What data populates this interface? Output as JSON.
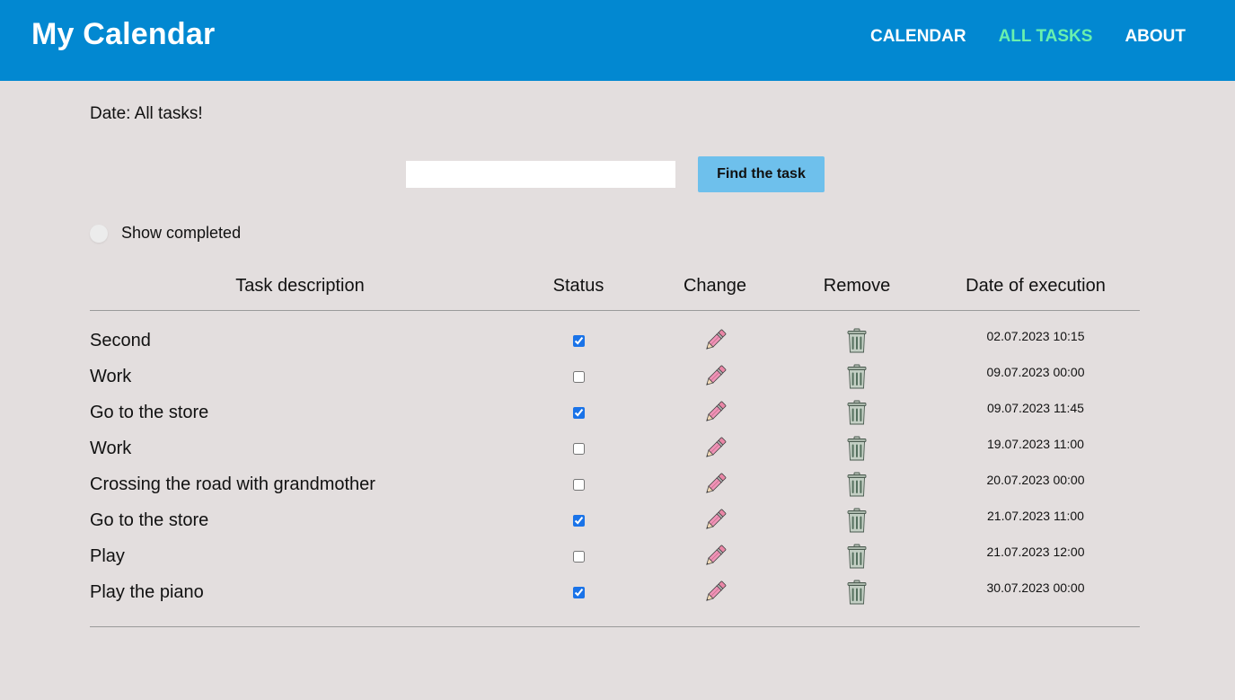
{
  "header": {
    "brand": "My Calendar",
    "nav": [
      {
        "label": "CALENDAR",
        "active": false
      },
      {
        "label": "ALL TASKS",
        "active": true
      },
      {
        "label": "ABOUT",
        "active": false
      }
    ],
    "colors": {
      "bar": "#0288d1",
      "active_link": "#69f0ae"
    }
  },
  "main": {
    "date_line": "Date: All tasks!",
    "search": {
      "value": "",
      "placeholder": ""
    },
    "find_button_label": "Find the task",
    "show_completed": {
      "label": "Show completed",
      "checked": false
    }
  },
  "table": {
    "headers": {
      "description": "Task description",
      "status": "Status",
      "change": "Change",
      "remove": "Remove",
      "date": "Date of execution"
    },
    "rows": [
      {
        "description": "Second",
        "done": true,
        "date": "02.07.2023 10:15",
        "change_icon": "pencil-icon",
        "remove_icon": "trash-icon"
      },
      {
        "description": "Work",
        "done": false,
        "date": "09.07.2023 00:00",
        "change_icon": "pencil-icon",
        "remove_icon": "trash-icon"
      },
      {
        "description": "Go to the store",
        "done": true,
        "date": "09.07.2023 11:45",
        "change_icon": "pencil-icon",
        "remove_icon": "trash-icon"
      },
      {
        "description": "Work",
        "done": false,
        "date": "19.07.2023 11:00",
        "change_icon": "pencil-icon",
        "remove_icon": "trash-icon"
      },
      {
        "description": "Crossing the road with grandmother",
        "done": false,
        "date": "20.07.2023 00:00",
        "change_icon": "pencil-icon",
        "remove_icon": "trash-icon"
      },
      {
        "description": "Go to the store",
        "done": true,
        "date": "21.07.2023 11:00",
        "change_icon": "pencil-icon",
        "remove_icon": "trash-icon"
      },
      {
        "description": "Play",
        "done": false,
        "date": "21.07.2023 12:00",
        "change_icon": "pencil-icon",
        "remove_icon": "trash-icon"
      },
      {
        "description": "Play the piano",
        "done": true,
        "date": "30.07.2023 00:00",
        "change_icon": "pencil-icon",
        "remove_icon": "trash-icon"
      }
    ]
  }
}
